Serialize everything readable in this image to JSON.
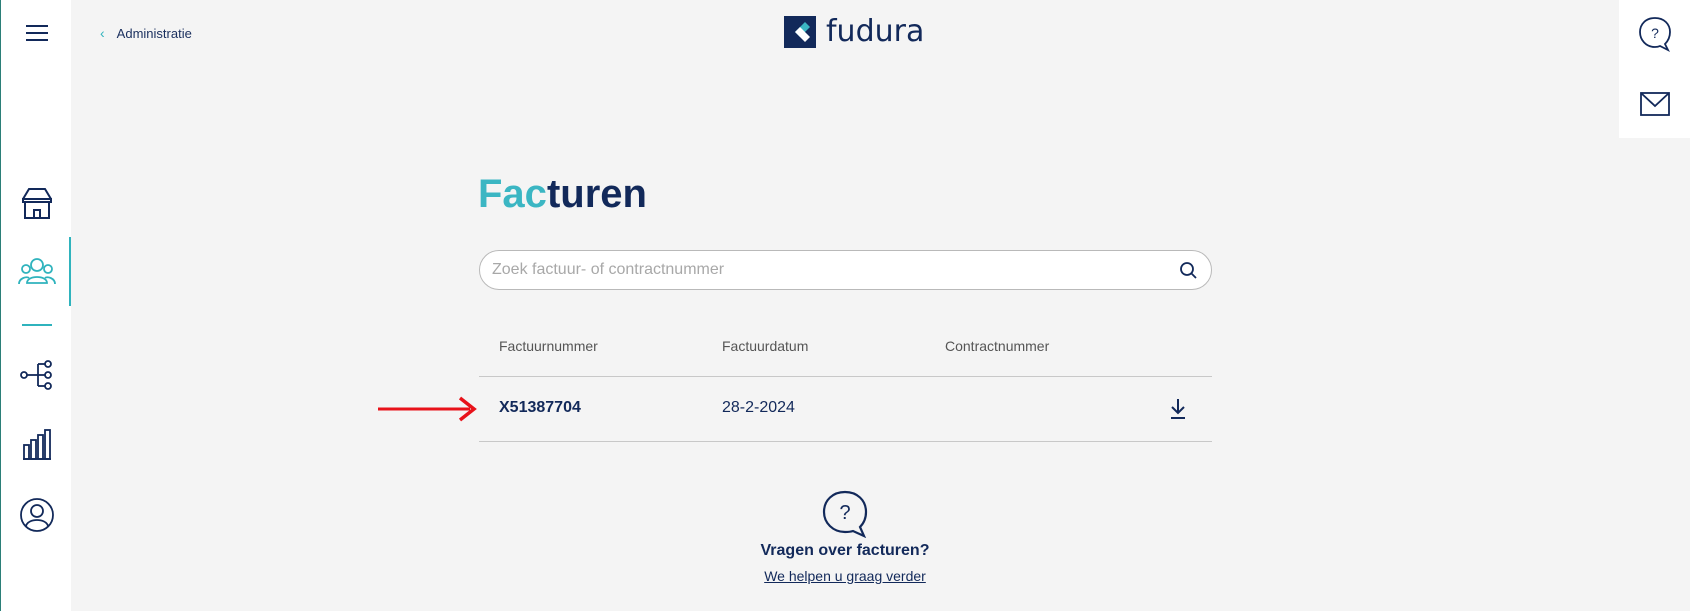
{
  "header": {
    "back_label": "Administratie",
    "logo_text": "fudura"
  },
  "page": {
    "title_part1": "Fac",
    "title_part2": "turen"
  },
  "search": {
    "placeholder": "Zoek factuur- of contractnummer",
    "value": ""
  },
  "table": {
    "columns": [
      "Factuurnummer",
      "Factuurdatum",
      "Contractnummer"
    ],
    "rows": [
      {
        "factuurnummer": "X51387704",
        "factuurdatum": "28-2-2024",
        "contractnummer": ""
      }
    ]
  },
  "help": {
    "title": "Vragen over facturen?",
    "link": "We helpen u graag verder"
  },
  "icons": {
    "left_nav": [
      "menu-icon",
      "store-icon",
      "customers-icon",
      "network-icon",
      "bar-chart-icon",
      "user-icon"
    ],
    "right_rail": [
      "help-icon",
      "mail-icon"
    ]
  },
  "colors": {
    "navy": "#12295a",
    "teal": "#3bb6c3",
    "annotation_arrow": "#e8121a"
  }
}
